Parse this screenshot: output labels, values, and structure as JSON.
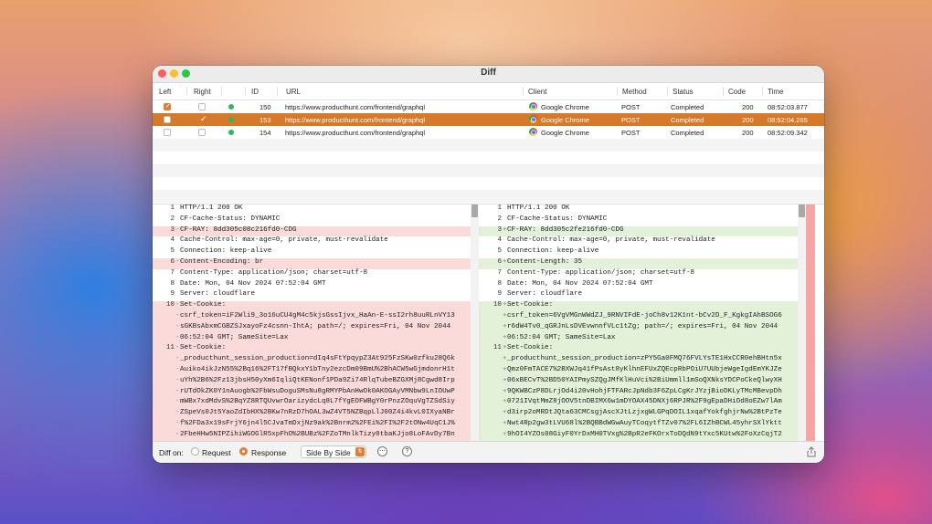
{
  "window": {
    "title": "Diff"
  },
  "table": {
    "headers": [
      "Left",
      "Right",
      "",
      "ID",
      "URL",
      "Client",
      "Method",
      "Status",
      "Code",
      "Time"
    ],
    "rows": [
      {
        "left": true,
        "right": false,
        "id": "150",
        "url": "https://www.producthunt.com/frontend/graphql",
        "client": "Google Chrome",
        "method": "POST",
        "status": "Completed",
        "code": "200",
        "time": "08:52:03.877",
        "selected": false
      },
      {
        "left": false,
        "right": true,
        "id": "153",
        "url": "https://www.producthunt.com/frontend/graphql",
        "client": "Google Chrome",
        "method": "POST",
        "status": "Completed",
        "code": "200",
        "time": "08:52:04.265",
        "selected": true
      },
      {
        "left": false,
        "right": false,
        "id": "154",
        "url": "https://www.producthunt.com/frontend/graphql",
        "client": "Google Chrome",
        "method": "POST",
        "status": "Completed",
        "code": "200",
        "time": "08:52:09.342",
        "selected": false
      }
    ]
  },
  "diff": {
    "left": [
      {
        "n": "1",
        "m": "",
        "t": "HTTP/1.1 200 OK",
        "k": ""
      },
      {
        "n": "2",
        "m": "",
        "t": "CF-Cache-Status: DYNAMIC",
        "k": ""
      },
      {
        "n": "3",
        "m": "-",
        "t": "CF-RAY: 8dd305c08c216fd0-CDG",
        "k": "del"
      },
      {
        "n": "4",
        "m": "",
        "t": "Cache-Control: max-age=0, private, must-revalidate",
        "k": ""
      },
      {
        "n": "5",
        "m": "",
        "t": "Connection: keep-alive",
        "k": ""
      },
      {
        "n": "6",
        "m": "-",
        "t": "Content-Encoding: br",
        "k": "del"
      },
      {
        "n": "7",
        "m": "",
        "t": "Content-Type: application/json; charset=utf-8",
        "k": ""
      },
      {
        "n": "8",
        "m": "",
        "t": "Date: Mon, 04 Nov 2024 07:52:04 GMT",
        "k": ""
      },
      {
        "n": "9",
        "m": "",
        "t": "Server: cloudflare",
        "k": ""
      },
      {
        "n": "10",
        "m": "-",
        "t": "Set-Cookie:",
        "k": "del"
      },
      {
        "n": "",
        "m": "-",
        "t": "csrf_token=iF2Wli9_3o16uCU4gM4c5kjsGssIjvx_HaAn-E-ssI2rh8uuRLnVY13",
        "k": "del"
      },
      {
        "n": "",
        "m": "-",
        "t": "sGKBsAbxmCGBZSJxayoFz4csnn-IhtA; path=/; expires=Fri, 04 Nov 2044",
        "k": "del"
      },
      {
        "n": "",
        "m": "-",
        "t": "06:52:04 GMT; SameSite=Lax",
        "k": "del"
      },
      {
        "n": "11",
        "m": "-",
        "t": "Set-Cookie:",
        "k": "del"
      },
      {
        "n": "",
        "m": "-",
        "t": "_producthunt_session_production=dIq4sFtYpqypZ3At925FzSKw0zfku28Q6k",
        "k": "del"
      },
      {
        "n": "",
        "m": "-",
        "t": "Auiko4ikJzN55%2Bq16%2FT17fBQkxY1bTny2ezcDm09BmU%2BhACW5wGjmdonrH1t",
        "k": "del"
      },
      {
        "n": "",
        "m": "-",
        "t": "uYh%2B6%2Fz13jbsH50yXm6IqliQtKENonf1PDa9Zi74RlqTubeBZGXMj8Cgwd8Irp",
        "k": "del"
      },
      {
        "n": "",
        "m": "-",
        "t": "rUTdOkZK0Y1nAuogb%2FbWsuDoguSMsNu8gRMYPbAnHwOk0AKOGAyVMNbw9LnIOUwP",
        "k": "del"
      },
      {
        "n": "",
        "m": "-",
        "t": "mWBx7xdMdvS%2BqYZ8RTQUvwrOarizydcLq8L7fYgEOFWBgY0rPnzZOquVgTZSdSiy",
        "k": "del"
      },
      {
        "n": "",
        "m": "-",
        "t": "ZSpeVs0Jt5YaoZdIbHX%2BKw7nRzD7hOAL3wZ4VT5NZBqpLlJ00Z4i4kvL0IXyaNBr",
        "k": "del"
      },
      {
        "n": "",
        "m": "-",
        "t": "f%2FDa3x19sFrjY6jn4l5CJvaTmDxjNz9ak%2Bnrm2%2FEi%2FI%2F2tONw4UqC1J%",
        "k": "del"
      },
      {
        "n": "",
        "m": "-",
        "t": "2FbeHHw5NIPZihiWGOGlR5xpFhO%2BUBz%2FZoTMnlkTizy0tbaKJjo8LoFAvDy7Bn",
        "k": "del"
      }
    ],
    "right": [
      {
        "n": "1",
        "m": "",
        "t": "HTTP/1.1 200 OK",
        "k": ""
      },
      {
        "n": "2",
        "m": "",
        "t": "CF-Cache-Status: DYNAMIC",
        "k": ""
      },
      {
        "n": "3",
        "m": "+",
        "t": "CF-RAY: 8dd305c2fe216fd0-CDG",
        "k": "add"
      },
      {
        "n": "4",
        "m": "",
        "t": "Cache-Control: max-age=0, private, must-revalidate",
        "k": ""
      },
      {
        "n": "5",
        "m": "",
        "t": "Connection: keep-alive",
        "k": ""
      },
      {
        "n": "6",
        "m": "+",
        "t": "Content-Length: 35",
        "k": "add"
      },
      {
        "n": "7",
        "m": "",
        "t": "Content-Type: application/json; charset=utf-8",
        "k": ""
      },
      {
        "n": "8",
        "m": "",
        "t": "Date: Mon, 04 Nov 2024 07:52:04 GMT",
        "k": ""
      },
      {
        "n": "9",
        "m": "",
        "t": "Server: cloudflare",
        "k": ""
      },
      {
        "n": "10",
        "m": "+",
        "t": "Set-Cookie:",
        "k": "add"
      },
      {
        "n": "",
        "m": "+",
        "t": "csrf_token=6VgVMGnWWdZJ_9RNVIFdE-joCh8v12K1nt-bCv2D_F_KgkgIAhBSOG6",
        "k": "add"
      },
      {
        "n": "",
        "m": "+",
        "t": "r6dW4Tv0_qGRJnLsDVEvwnnfVLc1tZg; path=/; expires=Fri, 04 Nov 2044",
        "k": "add"
      },
      {
        "n": "",
        "m": "+",
        "t": "06:52:04 GMT; SameSite=Lax",
        "k": "add"
      },
      {
        "n": "11",
        "m": "+",
        "t": "Set-Cookie:",
        "k": "add"
      },
      {
        "n": "",
        "m": "+",
        "t": "_producthunt_session_production=zPY5Ga0FMQ76FVLYsTE1HxCCR0ehBHtn5x",
        "k": "add"
      },
      {
        "n": "",
        "m": "+",
        "t": "Qmz0FmTACE7%2BXWJq41fPsAst8yKlhnEFUxZQEcpRbPOiU7UUbjeWgeIgdEmYKJZe",
        "k": "add"
      },
      {
        "n": "",
        "m": "+",
        "t": "06xBECvT%2BD50YAIPmySZQgJMfKlHuVci%2BiUmmll1mSoQXNksYDCPoCkeQlwyXH",
        "k": "add"
      },
      {
        "n": "",
        "m": "+",
        "t": "9QKWBCzP8DLrjOd4i20vHohjFTFARcJpNdb3F6ZpLCgKrJYzjBioDKLyTMcMBevpDh",
        "k": "add"
      },
      {
        "n": "",
        "m": "+",
        "t": "0721IVqtMmZ8jOOV5tnDBIMX6w1mDYOAX45DNXj6RPJR%2F9gEpaDHiOd8oEZw7lAm",
        "k": "add"
      },
      {
        "n": "",
        "m": "+",
        "t": "d3irp2oMRDtJQta63CMCsgjAscXJtLzjxgWLGPqDOIL1xqafYokfghjrNw%2BtPzTe",
        "k": "add"
      },
      {
        "n": "",
        "m": "+",
        "t": "Nwt4Rp2gw3tLVU68l%2BQBBdWGwAuyTCoqytfTZv07%2FL6IZhBCWL45yhrSXlYktt",
        "k": "add"
      },
      {
        "n": "",
        "m": "+",
        "t": "9hOI4YZOs08GiyF0YrDxMH0TVxg%2BpR2eFKOrxToDQdN9tYxc5KUtw%2FoXzCqjT2",
        "k": "add"
      }
    ]
  },
  "footer": {
    "diff_on_label": "Diff on:",
    "request_label": "Request",
    "response_label": "Response",
    "selected": "response",
    "mode_label": "Side By Side",
    "more_icon": "ellipsis-circle-icon",
    "help_label": "?",
    "share_icon": "share-icon"
  },
  "colors": {
    "accent": "#e07e34",
    "selection": "#d5792a",
    "deleted": "#fbdada",
    "added": "#e3f1d9"
  }
}
